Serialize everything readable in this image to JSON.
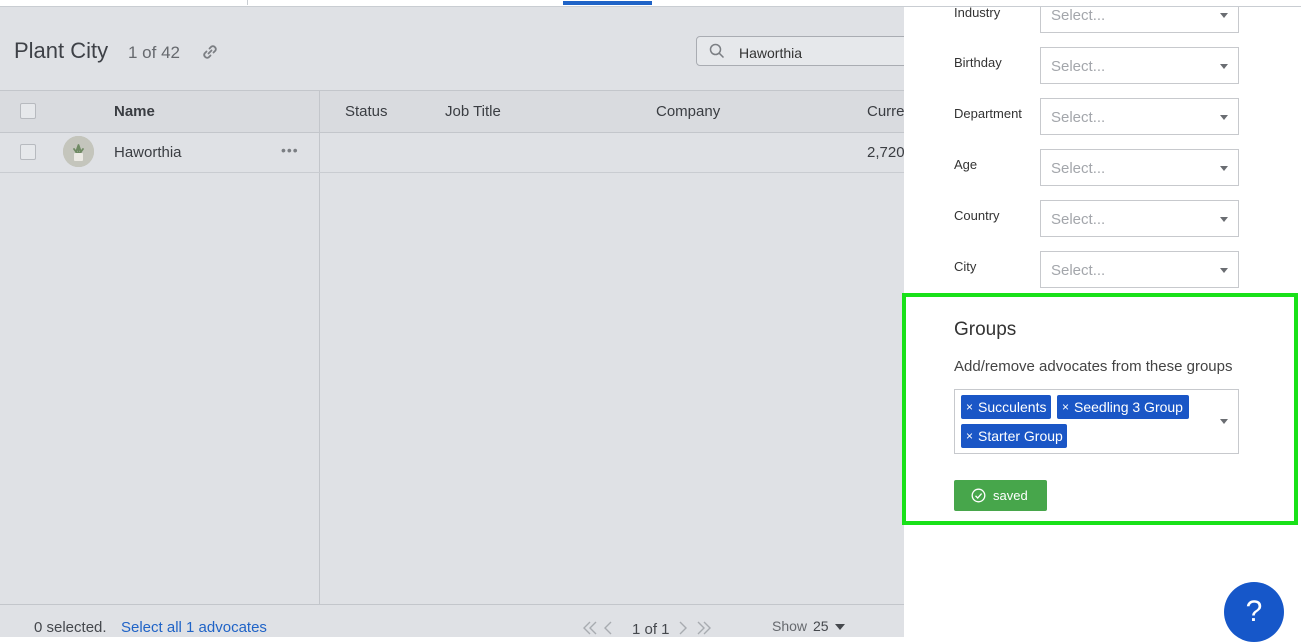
{
  "list": {
    "title": "Plant City",
    "count": "1 of 42",
    "search_value": "Haworthia",
    "columns": [
      "Name",
      "Status",
      "Job Title",
      "Company",
      "Curre"
    ],
    "rows": [
      {
        "name": "Haworthia",
        "status": "",
        "job_title": "",
        "company": "",
        "current": "2,720"
      }
    ],
    "footer": {
      "selected": "0 selected.",
      "select_all": "Select all 1 advocates",
      "page": "1 of 1",
      "show_label": "Show",
      "show_value": "25"
    }
  },
  "drawer": {
    "fields": [
      {
        "label": "Industry",
        "placeholder": "Select..."
      },
      {
        "label": "Birthday",
        "placeholder": "Select..."
      },
      {
        "label": "Department",
        "placeholder": "Select..."
      },
      {
        "label": "Age",
        "placeholder": "Select..."
      },
      {
        "label": "Country",
        "placeholder": "Select..."
      },
      {
        "label": "City",
        "placeholder": "Select..."
      }
    ],
    "groups": {
      "title": "Groups",
      "description": "Add/remove advocates from these groups",
      "chips": [
        "Succulents",
        "Seedling 3 Group",
        "Starter Group"
      ],
      "chip_remove": "×"
    },
    "saved_label": "saved"
  },
  "help_label": "?",
  "colors": {
    "accent": "#1f63c7",
    "chip": "#1a56c6",
    "saved": "#47a64b",
    "highlight": "#19e119",
    "help": "#1657c9"
  }
}
